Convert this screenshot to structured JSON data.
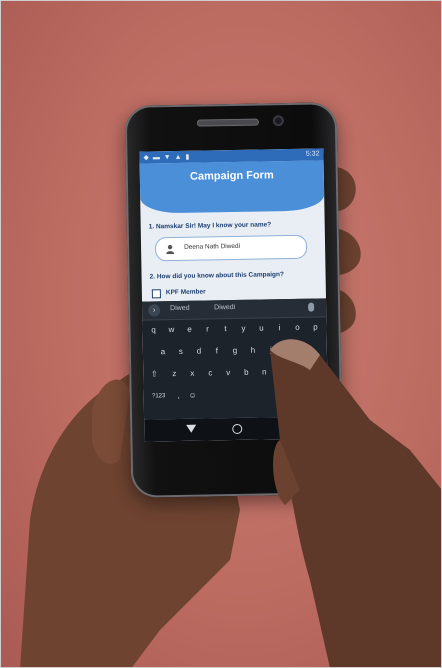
{
  "phone_screen": {
    "status_time": "5:32",
    "status_icons": "◆ ▬ ▼ ▲ ▮",
    "app_title": "Campaign Form",
    "question_1": "1. Namskar Sir! May I know your name?",
    "answer_1": "Deena Nath Diwedi",
    "question_2": "2. How did you know about this Campaign?",
    "option_1": "KPF Member"
  },
  "keyboard": {
    "suggestion_1": "Diwed",
    "suggestion_2": "Diwedi",
    "row_1": [
      "q",
      "w",
      "e",
      "r",
      "t",
      "y",
      "u",
      "i",
      "o",
      "p"
    ],
    "row_2": [
      "a",
      "s",
      "d",
      "f",
      "g",
      "h",
      "j",
      "k",
      "l"
    ],
    "row_3": [
      "⇧",
      "z",
      "x",
      "c",
      "v",
      "b",
      "n",
      "m",
      "⌫"
    ],
    "row_4": [
      "?123",
      ",",
      "☺",
      "",
      "",
      ".",
      "✓"
    ],
    "icons": [
      "chevron-right-icon",
      "mic-icon",
      "enter-check-icon"
    ]
  },
  "colors": {
    "background": "#bd6c62",
    "app_header": "#4a8fd8",
    "status_bar": "#2e6bb8",
    "keyboard": "#1d232b"
  }
}
